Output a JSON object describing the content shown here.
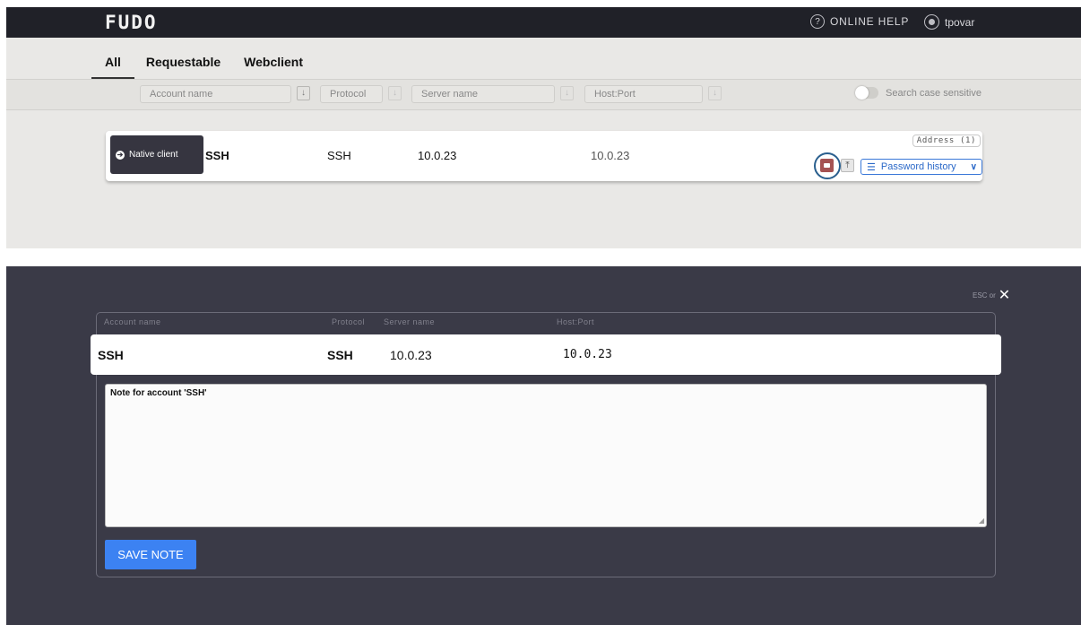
{
  "topbar": {
    "logo": "FUDO",
    "help_label": "ONLINE HELP",
    "username": "tpovar"
  },
  "tabs": [
    {
      "label": "All"
    },
    {
      "label": "Requestable"
    },
    {
      "label": "Webclient"
    }
  ],
  "filters": {
    "account_name": "Account name",
    "protocol": "Protocol",
    "server_name": "Server name",
    "host_port": "Host:Port",
    "case_sensitive_label": "Search case sensitive"
  },
  "row": {
    "native_client_label": "Native client",
    "account": "SSH",
    "protocol": "SSH",
    "server": "10.0.23",
    "host": "10.0.23",
    "address_badge": "Address (1)",
    "password_history_label": "Password history"
  },
  "modal": {
    "esc_label": "ESC or",
    "headers": {
      "account": "Account name",
      "protocol": "Protocol",
      "server": "Server name",
      "host": "Host:Port"
    },
    "row": {
      "account": "SSH",
      "protocol": "SSH",
      "server": "10.0.23",
      "host": "10.0.23"
    },
    "note_label": "Note for account 'SSH'",
    "save_label": "SAVE NOTE"
  }
}
